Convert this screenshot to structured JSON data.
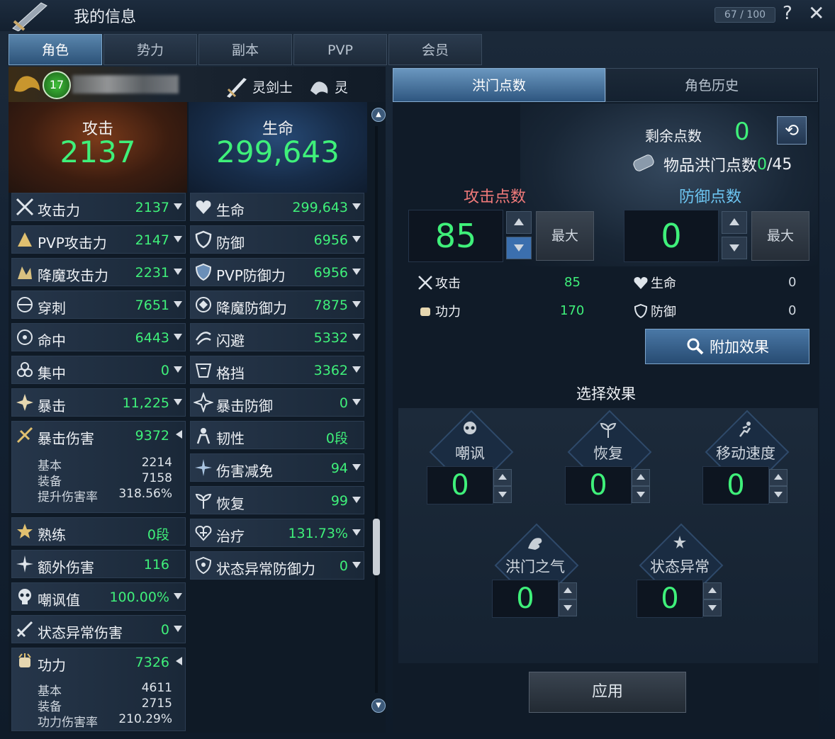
{
  "window": {
    "title": "我的信息",
    "counter": "67 / 100",
    "help": "?",
    "close": "✕"
  },
  "tabs": [
    "角色",
    "势力",
    "副本",
    "PVP",
    "会员"
  ],
  "character": {
    "level": "17",
    "class1": "灵剑士",
    "class2": "灵"
  },
  "summary": {
    "attack_label": "攻击",
    "attack_value": "2137",
    "hp_label": "生命",
    "hp_value": "299,643"
  },
  "left_stats": [
    {
      "label": "攻击力",
      "value": "2137"
    },
    {
      "label": "PVP攻击力",
      "value": "2147"
    },
    {
      "label": "降魔攻击力",
      "value": "2231"
    },
    {
      "label": "穿刺",
      "value": "7651"
    },
    {
      "label": "命中",
      "value": "6443"
    },
    {
      "label": "集中",
      "value": "0"
    },
    {
      "label": "暴击",
      "value": "11,225"
    },
    {
      "label": "暴击伤害",
      "value": "9372",
      "details": [
        {
          "label": "基本",
          "value": "2214"
        },
        {
          "label": "装备",
          "value": "7158"
        },
        {
          "label": "提升伤害率",
          "value": "318.56%"
        }
      ]
    },
    {
      "label": "熟练",
      "value": "0段"
    },
    {
      "label": "额外伤害",
      "value": "116"
    },
    {
      "label": "嘲讽值",
      "value": "100.00%"
    },
    {
      "label": "状态异常伤害",
      "value": "0"
    },
    {
      "label": "功力",
      "value": "7326",
      "details": [
        {
          "label": "基本",
          "value": "4611"
        },
        {
          "label": "装备",
          "value": "2715"
        },
        {
          "label": "功力伤害率",
          "value": "210.29%"
        }
      ]
    }
  ],
  "right_stats": [
    {
      "label": "生命",
      "value": "299,643"
    },
    {
      "label": "防御",
      "value": "6956"
    },
    {
      "label": "PVP防御力",
      "value": "6956"
    },
    {
      "label": "降魔防御力",
      "value": "7875"
    },
    {
      "label": "闪避",
      "value": "5332"
    },
    {
      "label": "格挡",
      "value": "3362"
    },
    {
      "label": "暴击防御",
      "value": "0"
    },
    {
      "label": "韧性",
      "value": "0段"
    },
    {
      "label": "伤害减免",
      "value": "94"
    },
    {
      "label": "恢复",
      "value": "99"
    },
    {
      "label": "治疗",
      "value": "131.73%"
    },
    {
      "label": "状态异常防御力",
      "value": "0"
    }
  ],
  "panel": {
    "tab_active": "洪门点数",
    "tab_other": "角色历史",
    "remaining_label": "剩余点数",
    "remaining_value": "0",
    "items_label": "物品洪门点数",
    "items_current": "0",
    "items_total": "/45",
    "attack_points_label": "攻击点数",
    "attack_points_value": "85",
    "defense_points_label": "防御点数",
    "defense_points_value": "0",
    "max_label": "最大",
    "atk_sub": [
      {
        "label": "攻击",
        "value": "85"
      },
      {
        "label": "功力",
        "value": "170"
      }
    ],
    "def_sub": [
      {
        "label": "生命",
        "value": "0"
      },
      {
        "label": "防御",
        "value": "0"
      }
    ],
    "add_effect": "附加效果",
    "select_effect": "选择效果",
    "effects": [
      {
        "label": "嘲讽",
        "value": "0"
      },
      {
        "label": "恢复",
        "value": "0"
      },
      {
        "label": "移动速度",
        "value": "0"
      },
      {
        "label": "洪门之气",
        "value": "0"
      },
      {
        "label": "状态异常",
        "value": "0"
      }
    ],
    "apply": "应用"
  },
  "colors": {
    "value_green": "#3ff07a",
    "attack_red": "#f07a7a",
    "defense_blue": "#6cc4f0",
    "tab_active": "#4a7aa8"
  }
}
